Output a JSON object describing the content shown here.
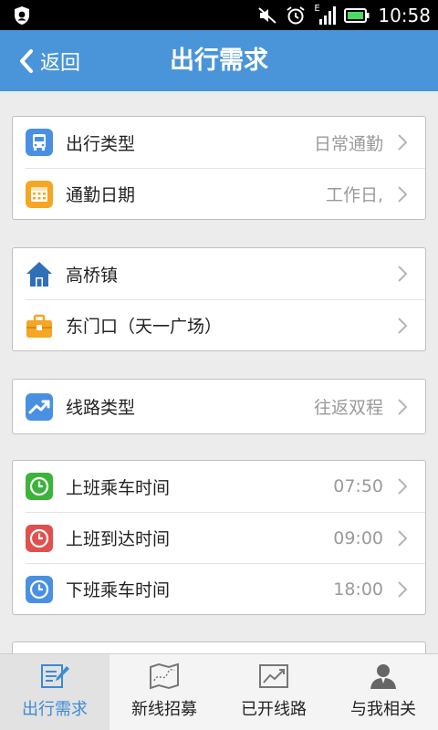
{
  "status_bar": {
    "time": "10:58",
    "network": "E"
  },
  "header": {
    "back_label": "返回",
    "title": "出行需求"
  },
  "cards": [
    {
      "rows": [
        {
          "icon": "bus-icon",
          "color": "#4a90e2",
          "label": "出行类型",
          "value": "日常通勤"
        },
        {
          "icon": "calendar-icon",
          "color": "#f5a623",
          "label": "通勤日期",
          "value": "工作日,"
        }
      ]
    },
    {
      "rows": [
        {
          "icon": "home-icon",
          "color": "#2f6fb8",
          "label": "高桥镇",
          "value": ""
        },
        {
          "icon": "briefcase-icon",
          "color": "#f5a623",
          "label": "东门口（天一广场）",
          "value": ""
        }
      ]
    },
    {
      "rows": [
        {
          "icon": "trend-icon",
          "color": "#4a90e2",
          "label": "线路类型",
          "value": "往返双程"
        }
      ]
    },
    {
      "rows": [
        {
          "icon": "clock-icon",
          "color": "#3cb33c",
          "label": "上班乘车时间",
          "value": "07:50"
        },
        {
          "icon": "clock-icon",
          "color": "#e0504d",
          "label": "上班到达时间",
          "value": "09:00"
        },
        {
          "icon": "clock-icon",
          "color": "#4a90e2",
          "label": "下班乘车时间",
          "value": "18:00"
        }
      ]
    }
  ],
  "tabs": [
    {
      "icon": "form-icon",
      "label": "出行需求",
      "active": true
    },
    {
      "icon": "map-route-icon",
      "label": "新线招募",
      "active": false
    },
    {
      "icon": "chart-icon",
      "label": "已开线路",
      "active": false
    },
    {
      "icon": "person-icon",
      "label": "与我相关",
      "active": false
    }
  ],
  "colors": {
    "header": "#4a95d9",
    "accent": "#3c8ad6",
    "background": "#ececec"
  }
}
